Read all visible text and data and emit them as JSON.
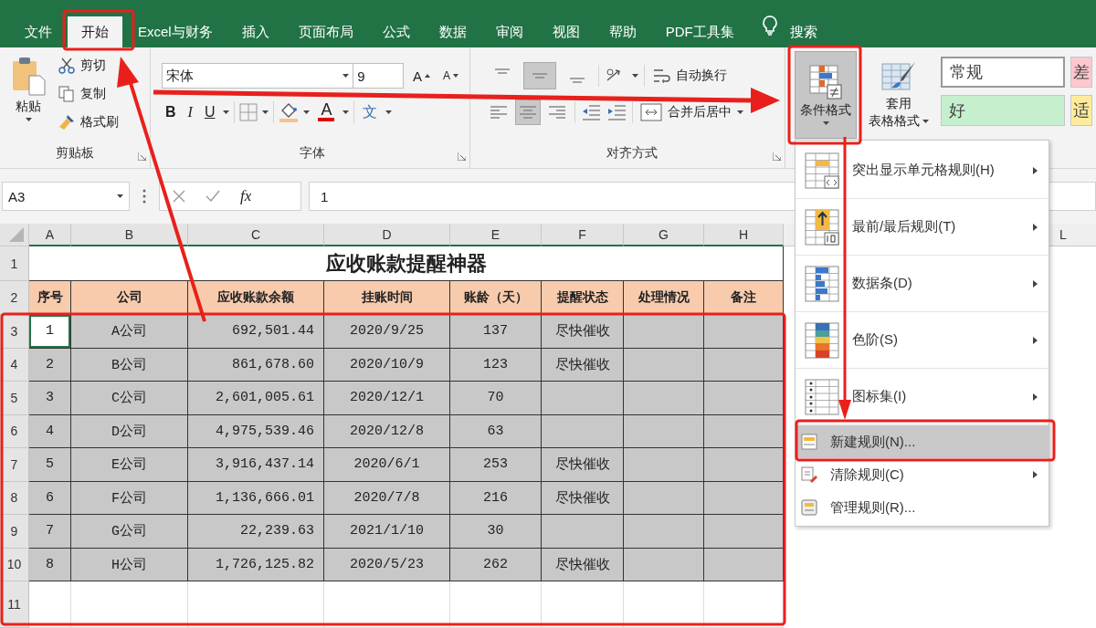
{
  "tabs": [
    {
      "label": "文件",
      "selected": false
    },
    {
      "label": "开始",
      "selected": true
    },
    {
      "label": "Excel与财务",
      "selected": false
    },
    {
      "label": "插入",
      "selected": false
    },
    {
      "label": "页面布局",
      "selected": false
    },
    {
      "label": "公式",
      "selected": false
    },
    {
      "label": "数据",
      "selected": false
    },
    {
      "label": "审阅",
      "selected": false
    },
    {
      "label": "视图",
      "selected": false
    },
    {
      "label": "帮助",
      "selected": false
    },
    {
      "label": "PDF工具集",
      "selected": false
    }
  ],
  "search_label": "搜索",
  "clipboard": {
    "paste": "粘贴",
    "cut": "剪切",
    "copy": "复制",
    "painter": "格式刷",
    "label": "剪贴板"
  },
  "font": {
    "font_name": "宋体",
    "font_size": "9",
    "grow": "A",
    "shrink": "A",
    "bold": "B",
    "italic": "I",
    "underline": "U",
    "font_color": "A",
    "phonetic": "文",
    "label": "字体"
  },
  "alignment": {
    "wrap": "自动换行",
    "merge": "合并后居中",
    "label": "对齐方式"
  },
  "styles": {
    "conditional": "条件格式",
    "conditional_expanded": true,
    "table_format": [
      "套用",
      "表格格式"
    ],
    "cell_styles": [
      {
        "label": "常规",
        "color": "#ffffff"
      },
      {
        "label": "好",
        "color": "#c6efce"
      },
      {
        "label": "差",
        "color": "#ffc7ce"
      },
      {
        "label": "适",
        "color": "#ffeb9c"
      }
    ]
  },
  "formula_bar": {
    "name_box": "A3",
    "function_button": "fx",
    "value": "1"
  },
  "sheet": {
    "columns": [
      "A",
      "B",
      "C",
      "D",
      "E",
      "F",
      "G",
      "H"
    ],
    "far_column": "L",
    "title_row": {
      "row_number": "1",
      "text": "应收账款提醒神器"
    },
    "header_row": {
      "row_number": "2",
      "cells": [
        "序号",
        "公司",
        "应收账款余额",
        "挂账时间",
        "账龄（天）",
        "提醒状态",
        "处理情况",
        "备注"
      ]
    },
    "rows": [
      {
        "row_number": "3",
        "selected": true,
        "active": true,
        "cells": [
          "1",
          "A公司",
          "692,501.44",
          "2020/9/25",
          "137",
          "尽快催收"
        ]
      },
      {
        "row_number": "4",
        "selected": true,
        "active": false,
        "cells": [
          "2",
          "B公司",
          "861,678.60",
          "2020/10/9",
          "123",
          "尽快催收"
        ]
      },
      {
        "row_number": "5",
        "selected": true,
        "active": false,
        "cells": [
          "3",
          "C公司",
          "2,601,005.61",
          "2020/12/1",
          "70"
        ]
      },
      {
        "row_number": "6",
        "selected": true,
        "active": false,
        "cells": [
          "4",
          "D公司",
          "4,975,539.46",
          "2020/12/8",
          "63"
        ]
      },
      {
        "row_number": "7",
        "selected": true,
        "active": false,
        "cells": [
          "5",
          "E公司",
          "3,916,437.14",
          "2020/6/1",
          "253",
          "尽快催收"
        ]
      },
      {
        "row_number": "8",
        "selected": true,
        "active": false,
        "cells": [
          "6",
          "F公司",
          "1,136,666.01",
          "2020/7/8",
          "216",
          "尽快催收"
        ]
      },
      {
        "row_number": "9",
        "selected": true,
        "active": false,
        "cells": [
          "7",
          "G公司",
          "22,239.63",
          "2021/1/10",
          "30"
        ]
      },
      {
        "row_number": "10",
        "selected": true,
        "active": false,
        "cells": [
          "8",
          "H公司",
          "1,726,125.82",
          "2020/5/23",
          "262",
          "尽快催收"
        ]
      },
      {
        "row_number": "11",
        "selected": false,
        "active": false
      }
    ]
  },
  "menu": [
    {
      "label": "突出显示单元格规则(H)",
      "kind": "highlight",
      "submenu": true,
      "selected": false
    },
    {
      "label": "最前/最后规则(T)",
      "kind": "topten",
      "submenu": true,
      "selected": false
    },
    {
      "label": "数据条(D)",
      "kind": "databars",
      "submenu": true,
      "selected": false
    },
    {
      "label": "色阶(S)",
      "kind": "colorscale",
      "submenu": true,
      "selected": false
    },
    {
      "label": "图标集(I)",
      "kind": "iconsets",
      "submenu": true,
      "selected": false
    },
    {
      "label": "新建规则(N)...",
      "kind": "new",
      "submenu": false,
      "selected": true
    },
    {
      "label": "清除规则(C)",
      "kind": "clear",
      "submenu": true,
      "selected": false
    },
    {
      "label": "管理规则(R)...",
      "kind": "manage",
      "submenu": false,
      "selected": false
    }
  ]
}
